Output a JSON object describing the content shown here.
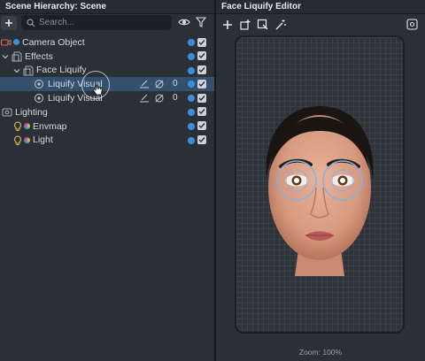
{
  "hierarchy": {
    "title": "Scene Hierarchy: Scene",
    "search_placeholder": "Search...",
    "items": [
      {
        "label": "Camera Object",
        "icon": "camera-icon"
      },
      {
        "label": "Effects",
        "icon": "effects-icon"
      },
      {
        "label": "Face Liquify",
        "icon": "face-liquify-icon"
      },
      {
        "label": "Liquify Visual",
        "icon": "liquify-visual-icon",
        "count": "0"
      },
      {
        "label": "Liquify Visual",
        "icon": "liquify-visual-icon",
        "count": "0"
      },
      {
        "label": "Lighting",
        "icon": "lighting-icon"
      },
      {
        "label": "Envmap",
        "icon": "bulb-icon"
      },
      {
        "label": "Light",
        "icon": "bulb-icon"
      }
    ]
  },
  "editor": {
    "title": "Face Liquify Editor",
    "zoom_label": "Zoom: 100%"
  },
  "colors": {
    "accent_blue": "#3b8fd9",
    "selection": "#34506f",
    "camera_orange": "#e0673a"
  }
}
